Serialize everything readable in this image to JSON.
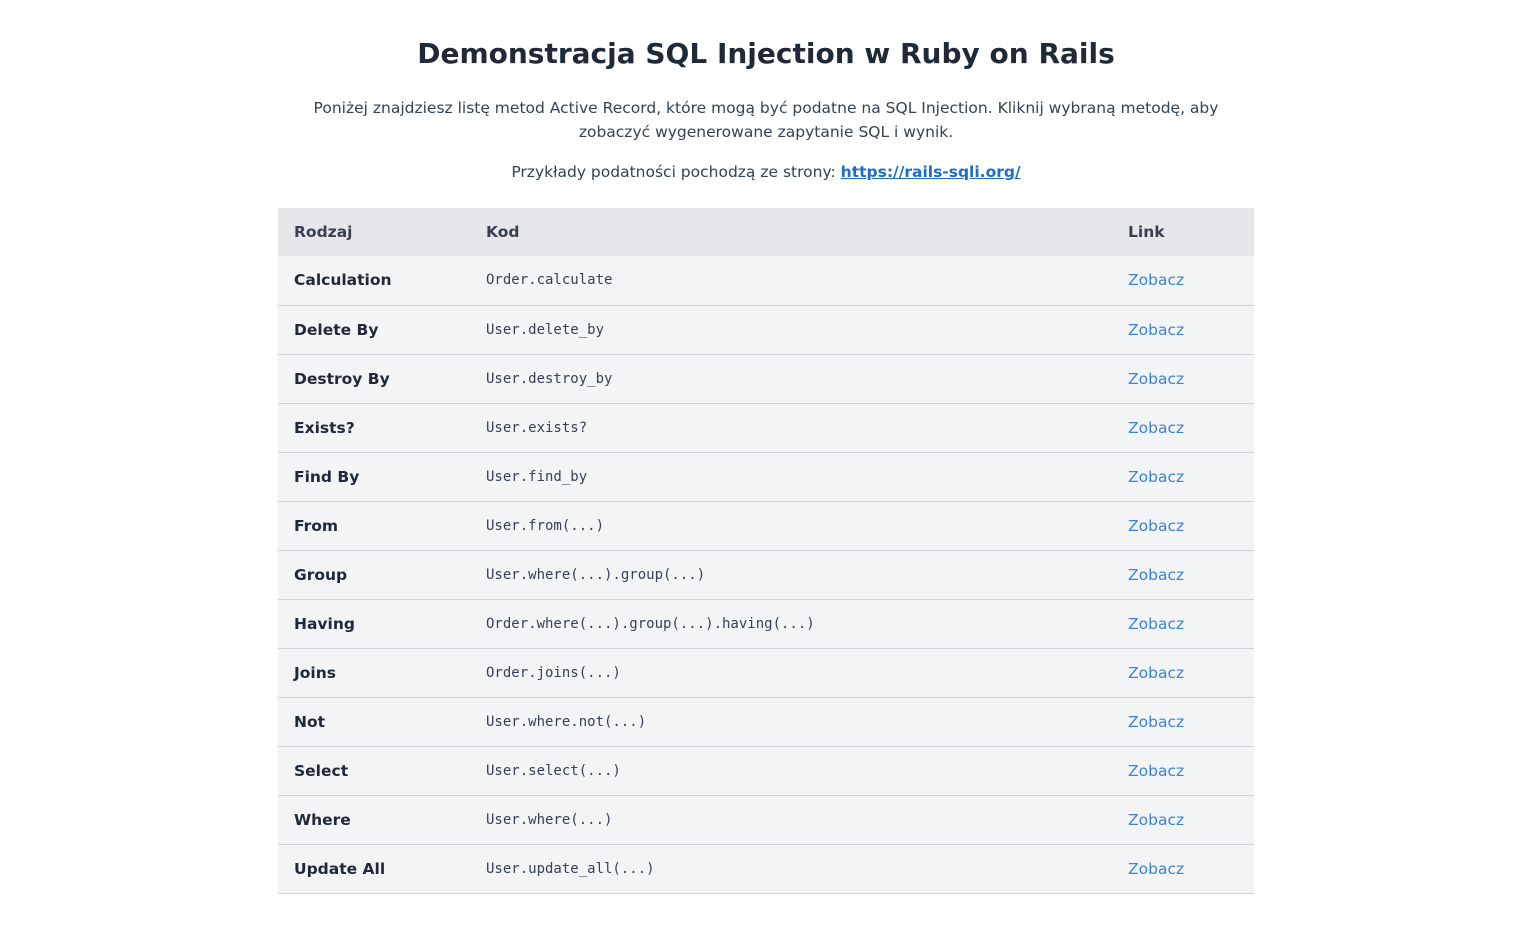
{
  "header": {
    "title": "Demonstracja SQL Injection w Ruby on Rails",
    "intro": "Poniżej znajdziesz listę metod Active Record, które mogą być podatne na SQL Injection. Kliknij wybraną metodę, aby zobaczyć wygenerowane zapytanie SQL i wynik.",
    "source_prefix": "Przykłady podatności pochodzą ze strony: ",
    "source_link": "https://rails-sqli.org/"
  },
  "table": {
    "columns": [
      "Rodzaj",
      "Kod",
      "Link"
    ],
    "rows": [
      {
        "kind": "Calculation",
        "code": "Order.calculate",
        "link": "Zobacz"
      },
      {
        "kind": "Delete By",
        "code": "User.delete_by",
        "link": "Zobacz"
      },
      {
        "kind": "Destroy By",
        "code": "User.destroy_by",
        "link": "Zobacz"
      },
      {
        "kind": "Exists?",
        "code": "User.exists?",
        "link": "Zobacz"
      },
      {
        "kind": "Find By",
        "code": "User.find_by",
        "link": "Zobacz"
      },
      {
        "kind": "From",
        "code": "User.from(...)",
        "link": "Zobacz"
      },
      {
        "kind": "Group",
        "code": "User.where(...).group(...)",
        "link": "Zobacz"
      },
      {
        "kind": "Having",
        "code": "Order.where(...).group(...).having(...)",
        "link": "Zobacz"
      },
      {
        "kind": "Joins",
        "code": "Order.joins(...)",
        "link": "Zobacz"
      },
      {
        "kind": "Not",
        "code": "User.where.not(...)",
        "link": "Zobacz"
      },
      {
        "kind": "Select",
        "code": "User.select(...)",
        "link": "Zobacz"
      },
      {
        "kind": "Where",
        "code": "User.where(...)",
        "link": "Zobacz"
      },
      {
        "kind": "Update All",
        "code": "User.update_all(...)",
        "link": "Zobacz"
      }
    ]
  },
  "colors": {
    "text": "#1f2937",
    "header_bg": "#e5e7eb",
    "row_bg": "#f3f4f6",
    "link": "#3b82d6",
    "source_link": "#1d6fc4"
  }
}
